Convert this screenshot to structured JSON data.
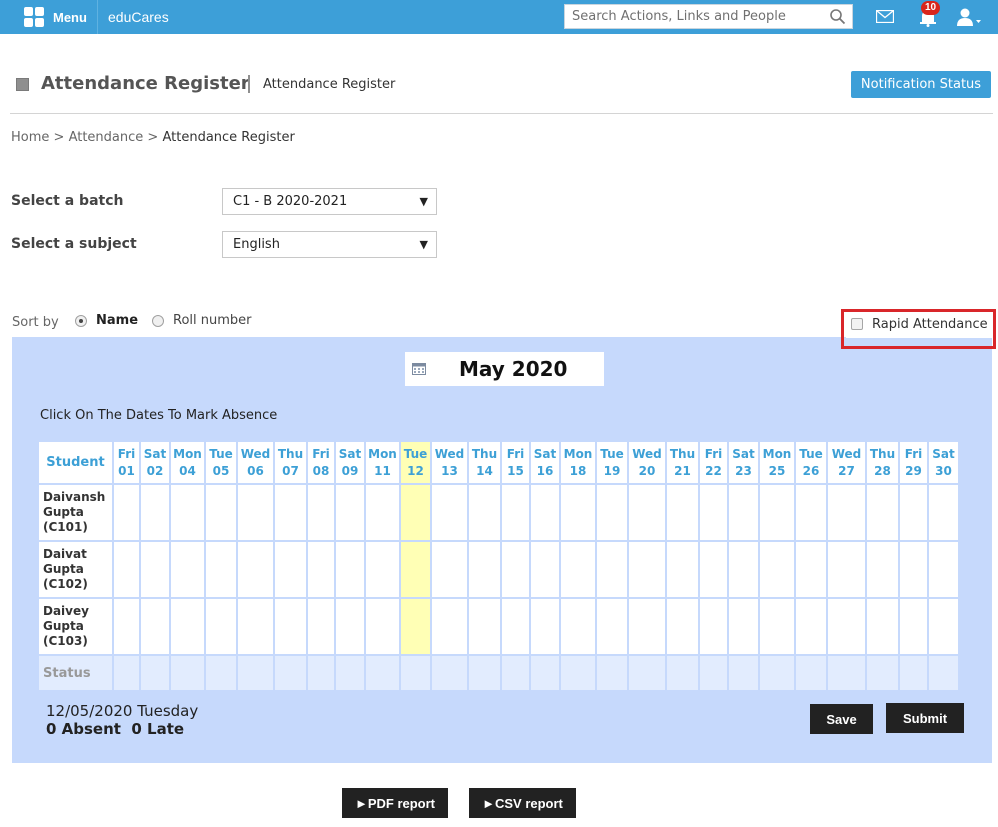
{
  "topbar": {
    "menu_label": "Menu",
    "brand": "eduCares",
    "search_placeholder": "Search Actions, Links and People",
    "notification_count": "10",
    "accent_color": "#3d9fd8"
  },
  "header": {
    "title": "Attendance Register",
    "subtitle": "Attendance Register",
    "notification_button": "Notification Status"
  },
  "breadcrumb": {
    "home": "Home",
    "sep1": ">",
    "attendance": "Attendance",
    "sep2": ">",
    "current": "Attendance Register"
  },
  "filters": {
    "batch_label": "Select a batch",
    "batch_value": "C1 - B 2020-2021",
    "subject_label": "Select a subject",
    "subject_value": "English"
  },
  "sort": {
    "label": "Sort by",
    "option_name": "Name",
    "option_roll": "Roll number",
    "selected": "Name"
  },
  "rapid_attendance_label": "Rapid Attendance",
  "calendar": {
    "month": "May 2020",
    "instruction": "Click On The Dates To Mark Absence",
    "student_header": "Student",
    "status_label": "Status",
    "highlighted_date": "12",
    "days": [
      {
        "dow": "Fri",
        "date": "01"
      },
      {
        "dow": "Sat",
        "date": "02"
      },
      {
        "dow": "Mon",
        "date": "04"
      },
      {
        "dow": "Tue",
        "date": "05"
      },
      {
        "dow": "Wed",
        "date": "06"
      },
      {
        "dow": "Thu",
        "date": "07"
      },
      {
        "dow": "Fri",
        "date": "08"
      },
      {
        "dow": "Sat",
        "date": "09"
      },
      {
        "dow": "Mon",
        "date": "11"
      },
      {
        "dow": "Tue",
        "date": "12"
      },
      {
        "dow": "Wed",
        "date": "13"
      },
      {
        "dow": "Thu",
        "date": "14"
      },
      {
        "dow": "Fri",
        "date": "15"
      },
      {
        "dow": "Sat",
        "date": "16"
      },
      {
        "dow": "Mon",
        "date": "18"
      },
      {
        "dow": "Tue",
        "date": "19"
      },
      {
        "dow": "Wed",
        "date": "20"
      },
      {
        "dow": "Thu",
        "date": "21"
      },
      {
        "dow": "Fri",
        "date": "22"
      },
      {
        "dow": "Sat",
        "date": "23"
      },
      {
        "dow": "Mon",
        "date": "25"
      },
      {
        "dow": "Tue",
        "date": "26"
      },
      {
        "dow": "Wed",
        "date": "27"
      },
      {
        "dow": "Thu",
        "date": "28"
      },
      {
        "dow": "Fri",
        "date": "29"
      },
      {
        "dow": "Sat",
        "date": "30"
      }
    ],
    "students": [
      {
        "lines": [
          "Daivansh",
          "Gupta",
          "(C101)"
        ]
      },
      {
        "lines": [
          "Daivat",
          "Gupta",
          "(C102)"
        ]
      },
      {
        "lines": [
          "Daivey",
          "Gupta",
          "(C103)"
        ]
      }
    ]
  },
  "summary": {
    "date_text": "12/05/2020 Tuesday",
    "counts_text": "0 Absent  0 Late"
  },
  "actions": {
    "save": "Save",
    "submit": "Submit",
    "pdf_report": "►PDF report",
    "csv_report": "►CSV report"
  }
}
